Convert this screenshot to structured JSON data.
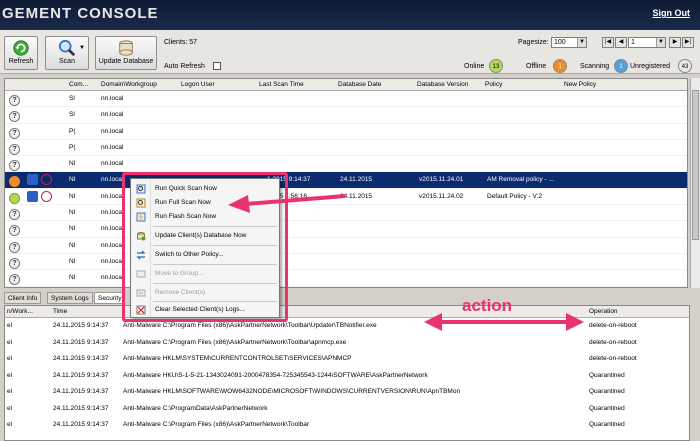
{
  "window": {
    "title": "GEMENT CONSOLE",
    "sign_out": "Sign Out"
  },
  "toolbar": {
    "refresh": "Refresh",
    "scan": "Scan",
    "update_database": "Update Database",
    "clients": "Clients: 57",
    "auto_refresh": "Auto Refresh",
    "pagesize_label": "Pagesize:",
    "pagesize_value": "100",
    "page_value": "1",
    "online_label": "Online",
    "online_count": "13",
    "offline_label": "Offline",
    "offline_count": "1",
    "scanning_label": "Scanning",
    "scanning_count": "1",
    "unregistered_label": "Unregistered",
    "unregistered_count": "43"
  },
  "colors": {
    "accent": "#e8336e",
    "selected_row": "#0b2a6f",
    "online": "#b6d94f",
    "offline": "#f08a2a",
    "scanning": "#4fa3e0"
  },
  "clients_table": {
    "columns": [
      "Com...",
      "Domain\\Workgroup",
      "Logon User",
      "Last Scan Time",
      "Database Date",
      "Database Version",
      "Policy",
      "New Policy"
    ],
    "rows": [
      {
        "name": "Sl",
        "domain": "nn.local",
        "last_scan": "",
        "db_date": "",
        "db_version": "",
        "policy": ""
      },
      {
        "name": "Sl",
        "domain": "nn.local",
        "last_scan": "",
        "db_date": "",
        "db_version": "",
        "policy": ""
      },
      {
        "name": "P(",
        "domain": "nn.local",
        "last_scan": "",
        "db_date": "",
        "db_version": "",
        "policy": ""
      },
      {
        "name": "P(",
        "domain": "nn.local",
        "last_scan": "",
        "db_date": "",
        "db_version": "",
        "policy": ""
      },
      {
        "name": "NI",
        "domain": "nn.local",
        "last_scan": "",
        "db_date": "",
        "db_version": "",
        "policy": ""
      },
      {
        "name": "NI",
        "domain": "nn.local",
        "last_scan": "1.2015 9:14:37",
        "db_date": "24.11.2015",
        "db_version": "v2015.11.24.01",
        "policy": "AM Removal policy - ..."
      },
      {
        "name": "NI",
        "domain": "nn.local",
        "last_scan": ":2015 ~:56:16",
        "db_date": "24.11.2015",
        "db_version": "v2015.11.24.02",
        "policy": "Default Policy - V:2"
      },
      {
        "name": "NI",
        "domain": "nn.local",
        "last_scan": "",
        "db_date": "",
        "db_version": "",
        "policy": ""
      },
      {
        "name": "NI",
        "domain": "nn.local",
        "last_scan": "",
        "db_date": "",
        "db_version": "",
        "policy": ""
      },
      {
        "name": "NI",
        "domain": "nn.local",
        "last_scan": "",
        "db_date": "",
        "db_version": "",
        "policy": ""
      },
      {
        "name": "NI",
        "domain": "nn.local",
        "last_scan": "",
        "db_date": "",
        "db_version": "",
        "policy": ""
      },
      {
        "name": "NI",
        "domain": "nn.local",
        "last_scan": "",
        "db_date": "",
        "db_version": "",
        "policy": ""
      }
    ]
  },
  "context_menu": {
    "items": [
      "Run Quick Scan Now",
      "Run Full Scan Now",
      "Run Flash Scan Now",
      "Update Client(s) Database Now",
      "Switch to Other Policy...",
      "Move to Group...",
      "Remove Client(s)",
      "Clear Selected Client(s) Logs..."
    ]
  },
  "tabs": [
    "Client Info",
    "System Logs",
    "Security"
  ],
  "log_table": {
    "columns": [
      "n/Work...",
      "Time",
      "",
      "Operation"
    ],
    "rows": [
      {
        "c0": "el",
        "time": "24.11.2015 9:14:37",
        "detail": "Anti-Malware  C:\\Program Files (x86)\\AskPartnerNetwork\\Toolbar\\Updater\\TBNotifier.exe",
        "op": "delete-on-reboot"
      },
      {
        "c0": "el",
        "time": "24.11.2015 9:14:37",
        "detail": "Anti-Malware  C:\\Program Files (x86)\\AskPartnerNetwork\\Toolbar\\apnmcp.exe",
        "op": "delete-on-reboot"
      },
      {
        "c0": "el",
        "time": "24.11.2015 9:14:37",
        "detail": "Anti-Malware  HKLM\\SYSTEM\\CURRENTCONTROLSET\\SERVICES\\APNMCP",
        "op": "delete-on-reboot"
      },
      {
        "c0": "el",
        "time": "24.11.2015 9:14:37",
        "detail": "Anti-Malware  HKU\\S-1-5-21-1343024091-2000478354-725345543-1244\\SOFTWARE\\AskPartnerNetwork",
        "op": "Quarantined"
      },
      {
        "c0": "el",
        "time": "24.11.2015 9:14:37",
        "detail": "Anti-Malware  HKLM\\SOFTWARE\\WOW6432NODE\\MICROSOFT\\WINDOWS\\CURRENTVERSION\\RUN\\ApnTBMon",
        "op": "Quarantined"
      },
      {
        "c0": "el",
        "time": "24.11.2015 9:14:37",
        "detail": "Anti-Malware  C:\\ProgramData\\AskPartnerNetwork",
        "op": "Quarantined"
      },
      {
        "c0": "el",
        "time": "24.11.2015 9:14:37",
        "detail": "Anti-Malware  C:\\Program Files (x86)\\AskPartnerNetwork\\Toolbar",
        "op": "Quarantined"
      }
    ]
  },
  "annotation": {
    "label": "action"
  }
}
